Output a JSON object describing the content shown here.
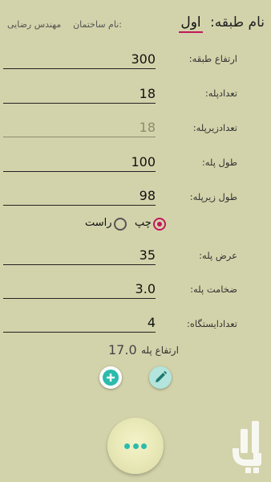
{
  "header": {
    "floor_label": "نام طبقه:",
    "floor_value": "اول",
    "building_label": "نام ساختمان:",
    "building_value": "مهندس رضایی"
  },
  "fields": {
    "floor_height": {
      "label": "ارتفاع طبقه:",
      "value": "300"
    },
    "stair_count": {
      "label": "تعدادپله:",
      "value": "18"
    },
    "riser_count": {
      "label": "تعدادزیرپله:",
      "value": "18"
    },
    "step_length": {
      "label": "طول پله:",
      "value": "100"
    },
    "riser_length": {
      "label": "طول زیرپله:",
      "value": "98"
    },
    "stair_width": {
      "label": "عرض پله:",
      "value": "35"
    },
    "stair_thickness": {
      "label": "ضخامت پله:",
      "value": "3.0"
    },
    "landing_count": {
      "label": "تعدادایستگاه:",
      "value": "4"
    }
  },
  "direction": {
    "left_label": "چپ",
    "right_label": "راست",
    "selected": "left"
  },
  "result": {
    "label": "ارتفاع پله",
    "value": "17.0"
  },
  "actions": {
    "add_icon": "plus-circle-icon",
    "edit_icon": "pencil-icon",
    "more_icon": "more-dots-icon"
  },
  "colors": {
    "background": "#d3d3ab",
    "accent": "#c2185b",
    "teal": "#2bbbad",
    "edit_button": "#b3e5dc"
  }
}
